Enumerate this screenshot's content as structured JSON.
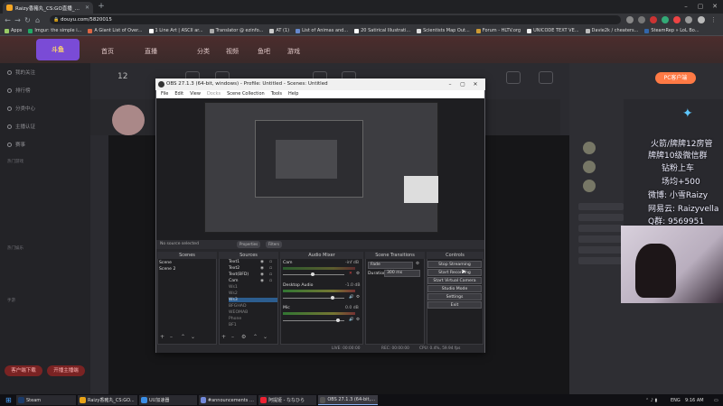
{
  "browser": {
    "tabs": [
      {
        "title": "Raizy香豬丸_CS:GO直播_斗鱼直播",
        "active": true
      }
    ],
    "address": "douyu.com/5820015",
    "bookmarks": [
      "Apps",
      "Imgur: the simple i...",
      "A Giant List of Over...",
      "1 Line Art | ASCII ar...",
      "Translator @ ezinfo...",
      "AT (1)",
      "List of Animas and...",
      "20 Satirical Illustrati...",
      "Scientists Map Out...",
      "Forum - HLTV.org",
      "UNICODE TEXT VE...",
      "Davie2k / cheaters...",
      "SteamRep » LoL Bo..."
    ]
  },
  "douyu": {
    "nav": [
      "首页",
      "直播",
      "分类",
      "视频",
      "鱼吧",
      "游戏",
      "鱼吧"
    ],
    "sidebar": [
      "我的关注",
      "排行榜",
      "分类中心",
      "主播认证",
      "赛事"
    ],
    "sidebar_section_1": "热门游戏",
    "sidebar_section_2": "热门娱乐",
    "sidebar_section_3": "手游",
    "sidebar_buttons": [
      "客户端下载",
      "开播主播端"
    ],
    "level": "12",
    "pc_button": "PC客户端",
    "overlay_text": [
      "火箭/牌牌12房管",
      "牌牌10级微信群",
      "钻粉上车",
      "场均+500",
      "微博: 小雪Raizy",
      "网易云: Raizyvella",
      "Q群: 9569951"
    ]
  },
  "obs": {
    "title": "OBS 27.1.3 (64-bit, windows) - Profile: Untitled - Scenes: Untitled",
    "menu": [
      "File",
      "Edit",
      "View",
      "Docks",
      "Scene Collection",
      "Tools",
      "Help"
    ],
    "no_source": "No source selected",
    "properties": "Properties",
    "filters": "Filters",
    "docks": {
      "scenes": "Scenes",
      "sources": "Sources",
      "mixer": "Audio Mixer",
      "transitions": "Scene Transitions",
      "controls": "Controls"
    },
    "scenes": [
      "Scene",
      "Scene 2"
    ],
    "sources": [
      "Text1",
      "Text2",
      "Text(BFD)",
      "Cam",
      "Ws1",
      "Ws2",
      "Ws3",
      "BFGHAD",
      "WEOMAB",
      "Phone",
      "BF1"
    ],
    "mixer": [
      {
        "name": "Cam",
        "db": "-inf dB"
      },
      {
        "name": "Desktop Audio",
        "db": "-1.0 dB"
      },
      {
        "name": "Mic",
        "db": "0.0 dB"
      }
    ],
    "transition": "Fade",
    "duration_label": "Duration",
    "duration": "300 ms",
    "controls": [
      "Stop Streaming",
      "Start Recording",
      "Start Virtual Camera",
      "Studio Mode",
      "Settings",
      "Exit"
    ],
    "status": {
      "live": "LIVE: 00:00:00",
      "rec": "REC: 00:00:00",
      "cpu": "CPU: 0.4%, 59.94 fps"
    }
  },
  "taskbar": {
    "items": [
      "Steam",
      "Raizy香豬丸_CS:GO...",
      "UU加速器",
      "#announcements - Dis...",
      "阿提娅 - ななひら",
      "OBS 27.1.3 (64-bit, wi..."
    ],
    "lang": "ENG",
    "time": "9:16 AM"
  }
}
